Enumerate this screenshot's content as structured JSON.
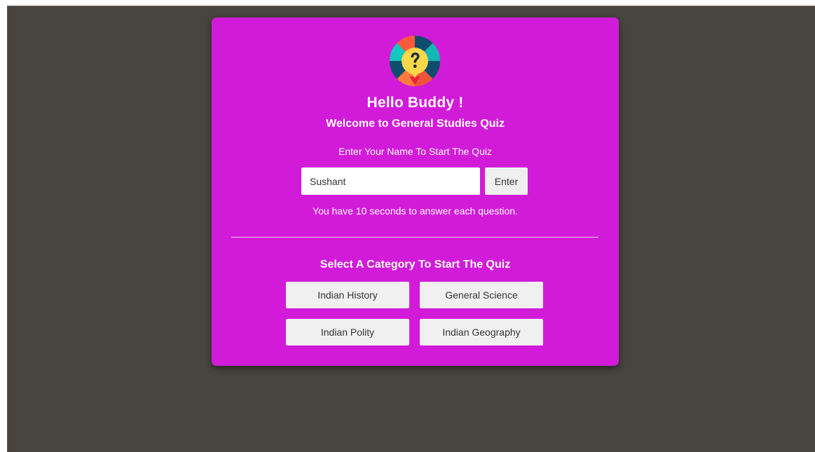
{
  "greeting": "Hello Buddy !",
  "subtitle": "Welcome to General Studies Quiz",
  "name_prompt": "Enter Your Name To Start The Quiz",
  "name_input": {
    "value": "Sushant",
    "placeholder": ""
  },
  "enter_label": "Enter",
  "timer_note": "You have 10 seconds to answer each question.",
  "category_title": "Select A Category To Start The Quiz",
  "categories": [
    {
      "label": "Indian History"
    },
    {
      "label": "General Science"
    },
    {
      "label": "Indian Polity"
    },
    {
      "label": "Indian Geography"
    }
  ],
  "icons": {
    "logo": "quiz-question-wheel-icon"
  },
  "colors": {
    "page_background": "#48453f",
    "card_background": "#d21bd9",
    "button_background": "#f0f0f0",
    "text_on_card": "#ffffff"
  }
}
